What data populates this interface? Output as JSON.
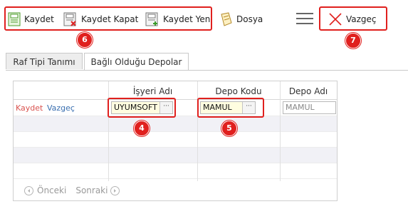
{
  "toolbar": {
    "save_label": "Kaydet",
    "save_close_label": "Kaydet Kapat",
    "save_new_label": "Kaydet Yeni",
    "file_label": "Dosya",
    "cancel_label": "Vazgeç"
  },
  "callouts": {
    "toolbar_group": "6",
    "cancel": "7",
    "workplace": "4",
    "depot_code": "5"
  },
  "tabs": [
    {
      "label": "Raf Tipi Tanımı",
      "active": false
    },
    {
      "label": "Bağlı Olduğu Depolar",
      "active": true
    }
  ],
  "grid": {
    "columns": [
      "İşyeri Adı",
      "Depo Kodu",
      "Depo Adı"
    ],
    "edit_row": {
      "save_link": "Kaydet",
      "cancel_link": "Vazgeç",
      "workplace_value": "UYUMSOFT",
      "depot_code_value": "MAMUL",
      "depot_name_placeholder": "MAMUL"
    },
    "lookup_button": "···"
  },
  "pager": {
    "prev_label": "Önceki",
    "next_label": "Sonraki"
  },
  "colors": {
    "accent_red": "#e0201e",
    "link_red": "#d9534f",
    "link_blue": "#3a6fb0",
    "input_yellow": "#fffde0"
  }
}
